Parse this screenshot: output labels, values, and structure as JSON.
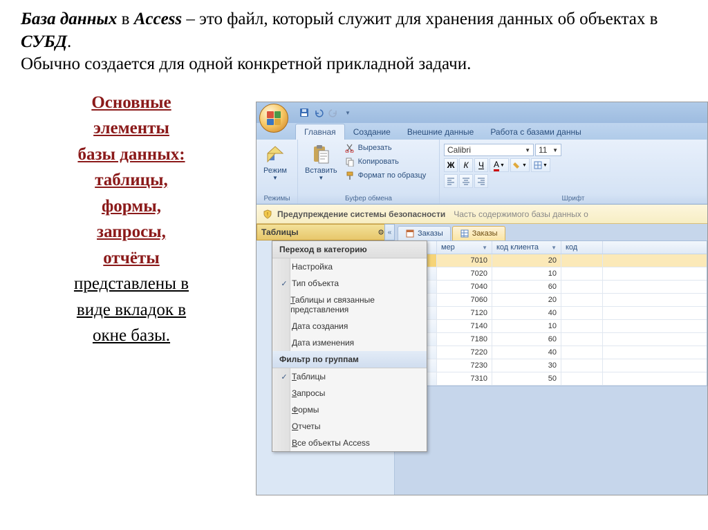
{
  "heading": {
    "t1": "База данных",
    "t2": " в ",
    "t3": "Access",
    "t4": " – это файл, который служит для хранения данных об объектах в ",
    "t5": "СУБД",
    "t6": ".",
    "t7": "Обычно создается для одной конкретной прикладной задачи."
  },
  "left": {
    "l1": "Основные",
    "l2": "элементы",
    "l3": "базы данных:",
    "l4": "таблицы,",
    "l5": "формы,",
    "l6": "запросы,",
    "l7": "отчёты",
    "l8": "представлены в",
    "l9": "виде вкладок в",
    "l10": "окне базы."
  },
  "ribbon": {
    "tabs": [
      "Главная",
      "Создание",
      "Внешние данные",
      "Работа с базами данны"
    ],
    "group_view": "Режимы",
    "btn_view": "Режим",
    "group_clip": "Буфер обмена",
    "btn_paste": "Вставить",
    "cut": "Вырезать",
    "copy": "Копировать",
    "fmt": "Формат по образцу",
    "group_font": "Шрифт",
    "font_name": "Calibri",
    "font_size": "11"
  },
  "security": {
    "label": "Предупреждение системы безопасности",
    "msg": "Часть содержимого базы данных о"
  },
  "nav": {
    "header": "Таблицы"
  },
  "menu": {
    "header": "Переход в категорию",
    "items": [
      {
        "label": "Настройка",
        "check": false
      },
      {
        "label": "Тип объекта",
        "check": true
      },
      {
        "label": "Таблицы и связанные представления",
        "check": false,
        "u": "Т"
      },
      {
        "label": "Дата создания",
        "check": false,
        "u": "Д"
      },
      {
        "label": "Дата изменения",
        "check": false,
        "u": "Д"
      }
    ],
    "header2": "Фильтр по группам",
    "items2": [
      {
        "label": "Таблицы",
        "check": true,
        "u": "Т"
      },
      {
        "label": "Запросы",
        "check": false,
        "u": "З"
      },
      {
        "label": "Формы",
        "check": false,
        "u": "Ф"
      },
      {
        "label": "Отчеты",
        "check": false,
        "u": "О"
      },
      {
        "label": "Все объекты Access",
        "check": false,
        "u": "В"
      }
    ]
  },
  "doctabs": [
    {
      "label": "Заказы",
      "active": false
    },
    {
      "label": "Заказы",
      "active": true
    }
  ],
  "gridheaders": [
    "мер",
    "код клиента",
    "код "
  ],
  "gridrows": [
    [
      7010,
      20
    ],
    [
      7020,
      10
    ],
    [
      7040,
      60
    ],
    [
      7060,
      20
    ],
    [
      7120,
      40
    ],
    [
      7140,
      10
    ],
    [
      7180,
      60
    ],
    [
      7220,
      40
    ],
    [
      7230,
      30
    ],
    [
      7310,
      50
    ]
  ],
  "chart_data": {
    "type": "table",
    "title": "Заказы",
    "columns": [
      "мер",
      "код клиента"
    ],
    "rows": [
      [
        7010,
        20
      ],
      [
        7020,
        10
      ],
      [
        7040,
        60
      ],
      [
        7060,
        20
      ],
      [
        7120,
        40
      ],
      [
        7140,
        10
      ],
      [
        7180,
        60
      ],
      [
        7220,
        40
      ],
      [
        7230,
        30
      ],
      [
        7310,
        50
      ]
    ]
  }
}
